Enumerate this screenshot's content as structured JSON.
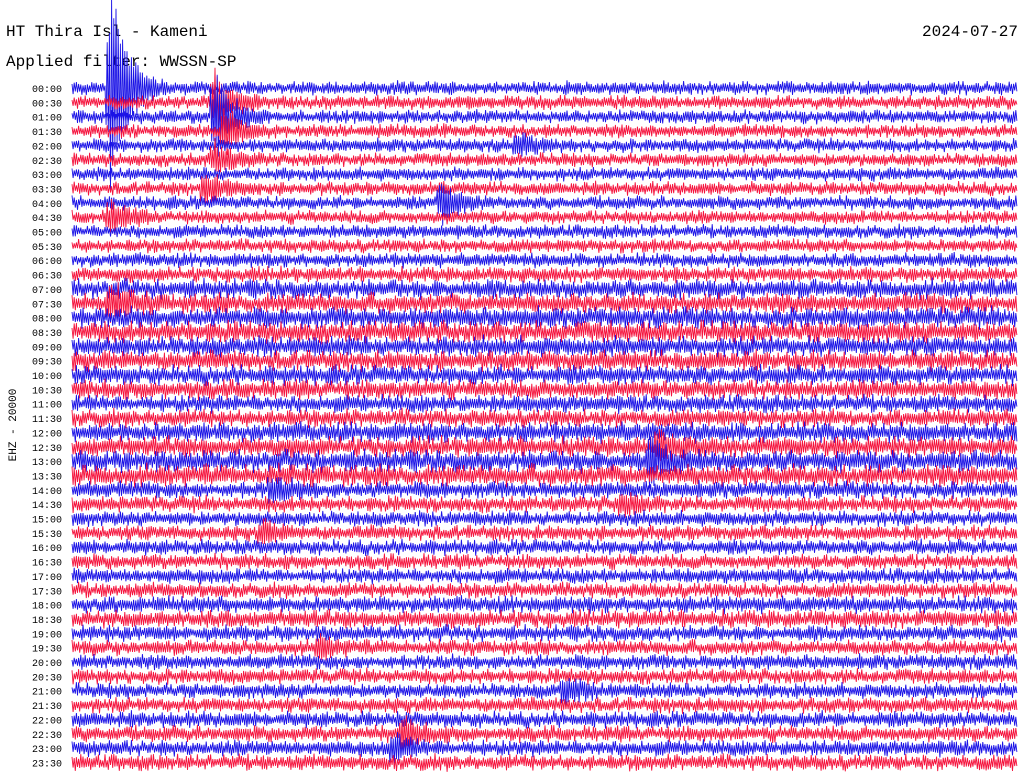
{
  "header": {
    "station": "HT Thira Isl - Kameni",
    "date": "2024-07-27",
    "filter": "Applied filter: WWSSN-SP"
  },
  "channel_label": "EHZ - 20000",
  "colors": {
    "trace_blue": "#1a12e6",
    "trace_red": "#f5123c",
    "text": "#000000",
    "background": "#ffffff"
  },
  "chart_data": {
    "type": "helicorder",
    "row_labels": [
      "00:00",
      "00:30",
      "01:00",
      "01:30",
      "02:00",
      "02:30",
      "03:00",
      "03:30",
      "04:00",
      "04:30",
      "05:00",
      "05:30",
      "06:00",
      "06:30",
      "07:00",
      "07:30",
      "08:00",
      "08:30",
      "09:00",
      "09:30",
      "10:00",
      "10:30",
      "11:00",
      "11:30",
      "12:00",
      "12:30",
      "13:00",
      "13:30",
      "14:00",
      "14:30",
      "15:00",
      "15:30",
      "16:00",
      "16:30",
      "17:00",
      "17:30",
      "18:00",
      "18:30",
      "19:00",
      "19:30",
      "20:00",
      "20:30",
      "21:00",
      "21:30",
      "22:00",
      "22:30",
      "23:00",
      "23:30"
    ],
    "row_colors": [
      "blue",
      "red",
      "blue",
      "red",
      "blue",
      "red",
      "blue",
      "red",
      "blue",
      "red",
      "blue",
      "red",
      "blue",
      "red",
      "blue",
      "red",
      "blue",
      "red",
      "blue",
      "red",
      "blue",
      "red",
      "blue",
      "red",
      "blue",
      "red",
      "blue",
      "red",
      "blue",
      "red",
      "blue",
      "red",
      "blue",
      "red",
      "blue",
      "red",
      "blue",
      "red",
      "blue",
      "red",
      "blue",
      "red",
      "blue",
      "red",
      "blue",
      "red",
      "blue",
      "red"
    ],
    "noise_level": [
      0.2,
      0.2,
      0.2,
      0.2,
      0.2,
      0.2,
      0.2,
      0.2,
      0.2,
      0.2,
      0.2,
      0.2,
      0.25,
      0.3,
      0.55,
      0.6,
      0.65,
      0.7,
      0.6,
      0.6,
      0.55,
      0.55,
      0.45,
      0.45,
      0.6,
      0.6,
      0.7,
      0.7,
      0.4,
      0.35,
      0.3,
      0.3,
      0.3,
      0.3,
      0.3,
      0.3,
      0.4,
      0.45,
      0.35,
      0.3,
      0.3,
      0.3,
      0.3,
      0.3,
      0.35,
      0.35,
      0.35,
      0.35
    ],
    "events": [
      {
        "row": 0,
        "x": 0.04,
        "amp": 14
      },
      {
        "row": 1,
        "x": 0.15,
        "amp": 4
      },
      {
        "row": 2,
        "x": 0.15,
        "amp": 6
      },
      {
        "row": 3,
        "x": 0.16,
        "amp": 3
      },
      {
        "row": 5,
        "x": 0.15,
        "amp": 2
      },
      {
        "row": 7,
        "x": 0.14,
        "amp": 2
      },
      {
        "row": 8,
        "x": 0.39,
        "amp": 2.5
      },
      {
        "row": 4,
        "x": 0.47,
        "amp": 1.2
      },
      {
        "row": 9,
        "x": 0.04,
        "amp": 2
      },
      {
        "row": 15,
        "x": 0.04,
        "amp": 2
      },
      {
        "row": 26,
        "x": 0.61,
        "amp": 2.5
      },
      {
        "row": 25,
        "x": 0.62,
        "amp": 1.5
      },
      {
        "row": 28,
        "x": 0.21,
        "amp": 1.5
      },
      {
        "row": 29,
        "x": 0.58,
        "amp": 1.2
      },
      {
        "row": 31,
        "x": 0.2,
        "amp": 1.2
      },
      {
        "row": 39,
        "x": 0.26,
        "amp": 1.2
      },
      {
        "row": 42,
        "x": 0.52,
        "amp": 1.5
      },
      {
        "row": 45,
        "x": 0.35,
        "amp": 1.8
      },
      {
        "row": 46,
        "x": 0.34,
        "amp": 1.5
      }
    ]
  }
}
